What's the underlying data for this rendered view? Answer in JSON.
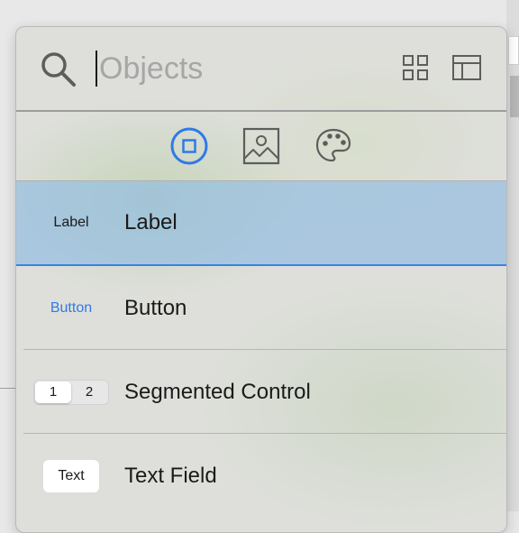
{
  "search": {
    "placeholder": "Objects"
  },
  "filters": [
    {
      "name": "objects",
      "selected": true
    },
    {
      "name": "media",
      "selected": false
    },
    {
      "name": "colors",
      "selected": false
    }
  ],
  "items": [
    {
      "thumb": "Label",
      "name": "Label",
      "selected": true
    },
    {
      "thumb": "Button",
      "name": "Button",
      "selected": false
    },
    {
      "thumb_segments": [
        "1",
        "2"
      ],
      "name": "Segmented Control",
      "selected": false
    },
    {
      "thumb": "Text",
      "name": "Text Field",
      "selected": false
    }
  ],
  "colors": {
    "accent": "#3b82e3",
    "selection": "#a9c4de",
    "button_text": "#2f7ae5"
  },
  "icons": {
    "search": "magnifying-glass-icon",
    "grid_view": "grid-view-icon",
    "detail_view": "detail-view-icon",
    "objects": "square-in-circle-icon",
    "media": "photo-icon",
    "colors": "palette-icon"
  }
}
